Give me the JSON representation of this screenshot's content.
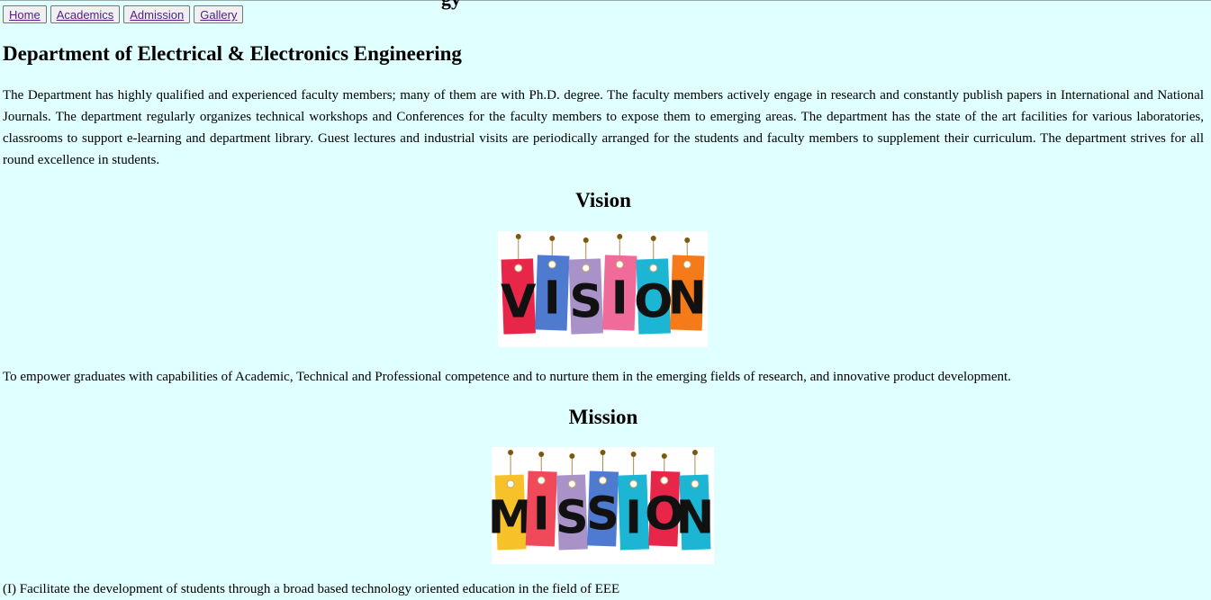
{
  "page": {
    "clipped_title": "gy",
    "background": "#e0ffff"
  },
  "nav": {
    "items": [
      {
        "label": "Home"
      },
      {
        "label": "Academics"
      },
      {
        "label": "Admission"
      },
      {
        "label": "Gallery"
      }
    ],
    "link_color": "#551a8b"
  },
  "department": {
    "title": "Department of Electrical & Electronics Engineering",
    "intro": "The Department has highly qualified and experienced faculty members; many of them are with Ph.D. degree. The faculty members actively engage in research and constantly publish papers in International and National Journals. The department regularly organizes technical workshops and Conferences for the faculty members to expose them to emerging areas. The department has the state of the art facilities for various laboratories, classrooms to support e-learning and department library. Guest lectures and industrial visits are periodically arranged for the students and faculty members to supplement their curriculum. The department strives for all round excellence in students."
  },
  "vision": {
    "heading": "Vision",
    "banner_letters": [
      "V",
      "I",
      "S",
      "I",
      "O",
      "N"
    ],
    "banner_colors": [
      "#e8264a",
      "#4e7bd0",
      "#a892c8",
      "#f06a9a",
      "#1db5d4",
      "#f47a1a"
    ],
    "text": "To empower graduates with capabilities of Academic, Technical and Professional competence and to nurture them in the emerging fields of research, and innovative product development."
  },
  "mission": {
    "heading": "Mission",
    "banner_letters": [
      "M",
      "I",
      "S",
      "S",
      "I",
      "O",
      "N"
    ],
    "banner_colors": [
      "#f7c12a",
      "#f04a5a",
      "#a892c8",
      "#4e7bd0",
      "#1db5d4",
      "#e8264a",
      "#1db5d4"
    ],
    "first_item": "(I) Facilitate the development of students through a broad based technology oriented education in the field of EEE"
  }
}
